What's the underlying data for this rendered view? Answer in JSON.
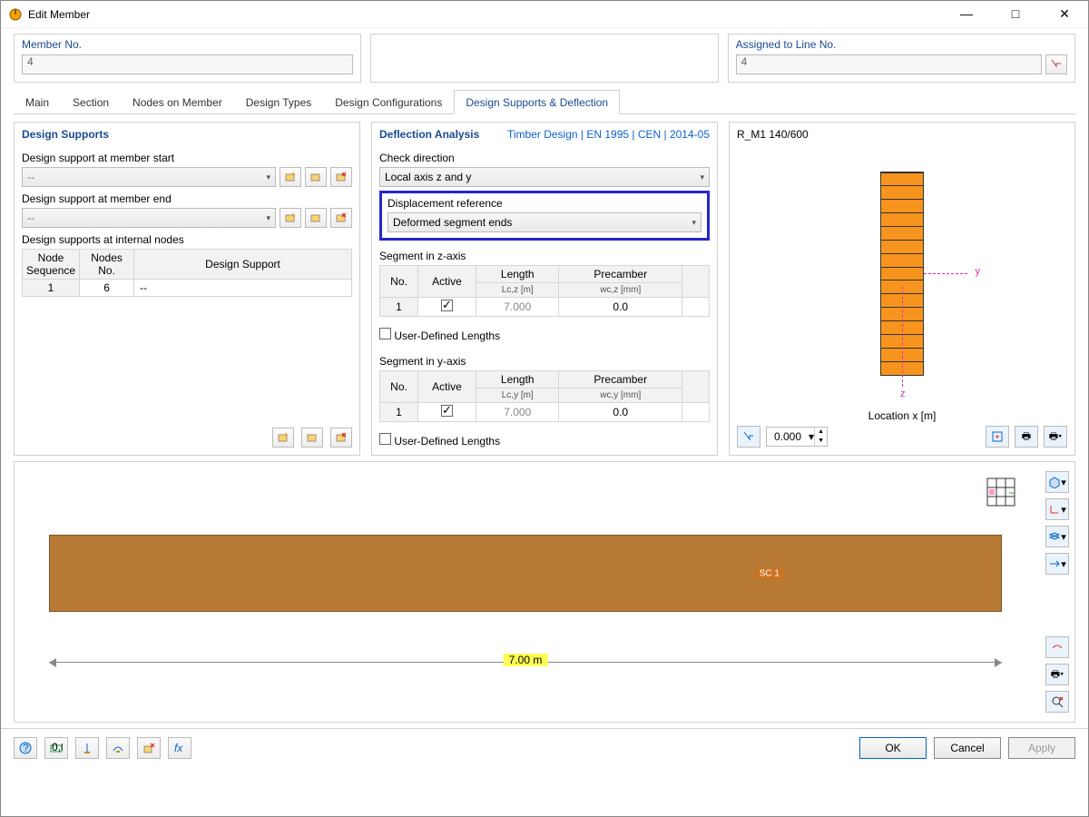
{
  "window": {
    "title": "Edit Member"
  },
  "top": {
    "member_no_label": "Member No.",
    "member_no_value": "4",
    "assigned_label": "Assigned to Line No.",
    "assigned_value": "4"
  },
  "tabs": [
    "Main",
    "Section",
    "Nodes on Member",
    "Design Types",
    "Design Configurations",
    "Design Supports & Deflection"
  ],
  "active_tab": 5,
  "design_supports": {
    "title": "Design Supports",
    "start_label": "Design support at member start",
    "start_value": "--",
    "end_label": "Design support at member end",
    "end_value": "--",
    "internal_label": "Design supports at internal nodes",
    "tbl_headers": {
      "seq": "Node Sequence",
      "nodes": "Nodes No.",
      "ds": "Design Support"
    },
    "tbl_row": {
      "seq": "1",
      "nodes": "6",
      "ds": "--"
    }
  },
  "deflection": {
    "title": "Deflection Analysis",
    "standard": "Timber Design | EN 1995 | CEN | 2014-05",
    "check_dir_label": "Check direction",
    "check_dir_value": "Local axis z and y",
    "disp_ref_label": "Displacement reference",
    "disp_ref_value": "Deformed segment ends",
    "seg_z_label": "Segment in z-axis",
    "seg_y_label": "Segment in y-axis",
    "seg_headers": {
      "no": "No.",
      "active": "Active",
      "length": "Length",
      "precamber": "Precamber"
    },
    "seg_sub": {
      "lz": "Lc,z [m]",
      "ly": "Lc,y [m]",
      "wz": "wc,z [mm]",
      "wy": "wc,y [mm]"
    },
    "seg_z_row": {
      "no": "1",
      "length": "7.000",
      "precamber": "0.0"
    },
    "seg_y_row": {
      "no": "1",
      "length": "7.000",
      "precamber": "0.0"
    },
    "user_def": "User-Defined Lengths"
  },
  "preview": {
    "section_name": "R_M1 140/600",
    "loc_label": "Location x [m]",
    "loc_value": "0.000",
    "axis_y": "y",
    "axis_z": "z"
  },
  "bottom": {
    "beam_tag": "SC 1",
    "dim": "7.00 m"
  },
  "buttons": {
    "ok": "OK",
    "cancel": "Cancel",
    "apply": "Apply"
  },
  "chart_data": {
    "type": "table",
    "title": "Deflection segment lengths",
    "series": [
      {
        "name": "Segment in z-axis",
        "fields": {
          "No.": 1,
          "Active": true,
          "Length Lc,z [m]": 7.0,
          "Precamber wc,z [mm]": 0.0
        }
      },
      {
        "name": "Segment in y-axis",
        "fields": {
          "No.": 1,
          "Active": true,
          "Length Lc,y [m]": 7.0,
          "Precamber wc,y [mm]": 0.0
        }
      }
    ],
    "member_length_m": 7.0
  }
}
